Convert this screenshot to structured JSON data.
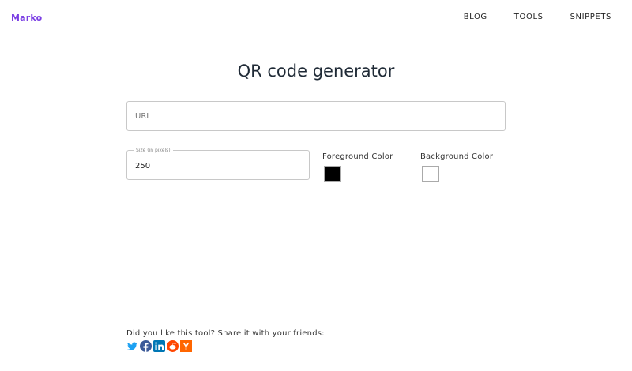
{
  "brand": "Marko",
  "nav": {
    "blog": "BLOG",
    "tools": "TOOLS",
    "snippets": "SNIPPETS"
  },
  "title": "QR code generator",
  "url_field": {
    "placeholder": "URL",
    "value": ""
  },
  "size_field": {
    "legend": "Size (in pixels)",
    "value": "250"
  },
  "foreground": {
    "label": "Foreground Color",
    "color": "#000000"
  },
  "background": {
    "label": "Background Color",
    "color": "#ffffff"
  },
  "share": {
    "text": "Did you like this tool? Share it with your friends:",
    "icons": [
      "twitter-icon",
      "facebook-icon",
      "linkedin-icon",
      "reddit-icon",
      "hacker-news-icon"
    ]
  },
  "colors": {
    "brand": "#7b3fe4",
    "twitter": "#1da1f2",
    "facebook": "#3b5998",
    "linkedin": "#0077b5",
    "reddit": "#ff4500",
    "hacker_news": "#ff6600"
  }
}
